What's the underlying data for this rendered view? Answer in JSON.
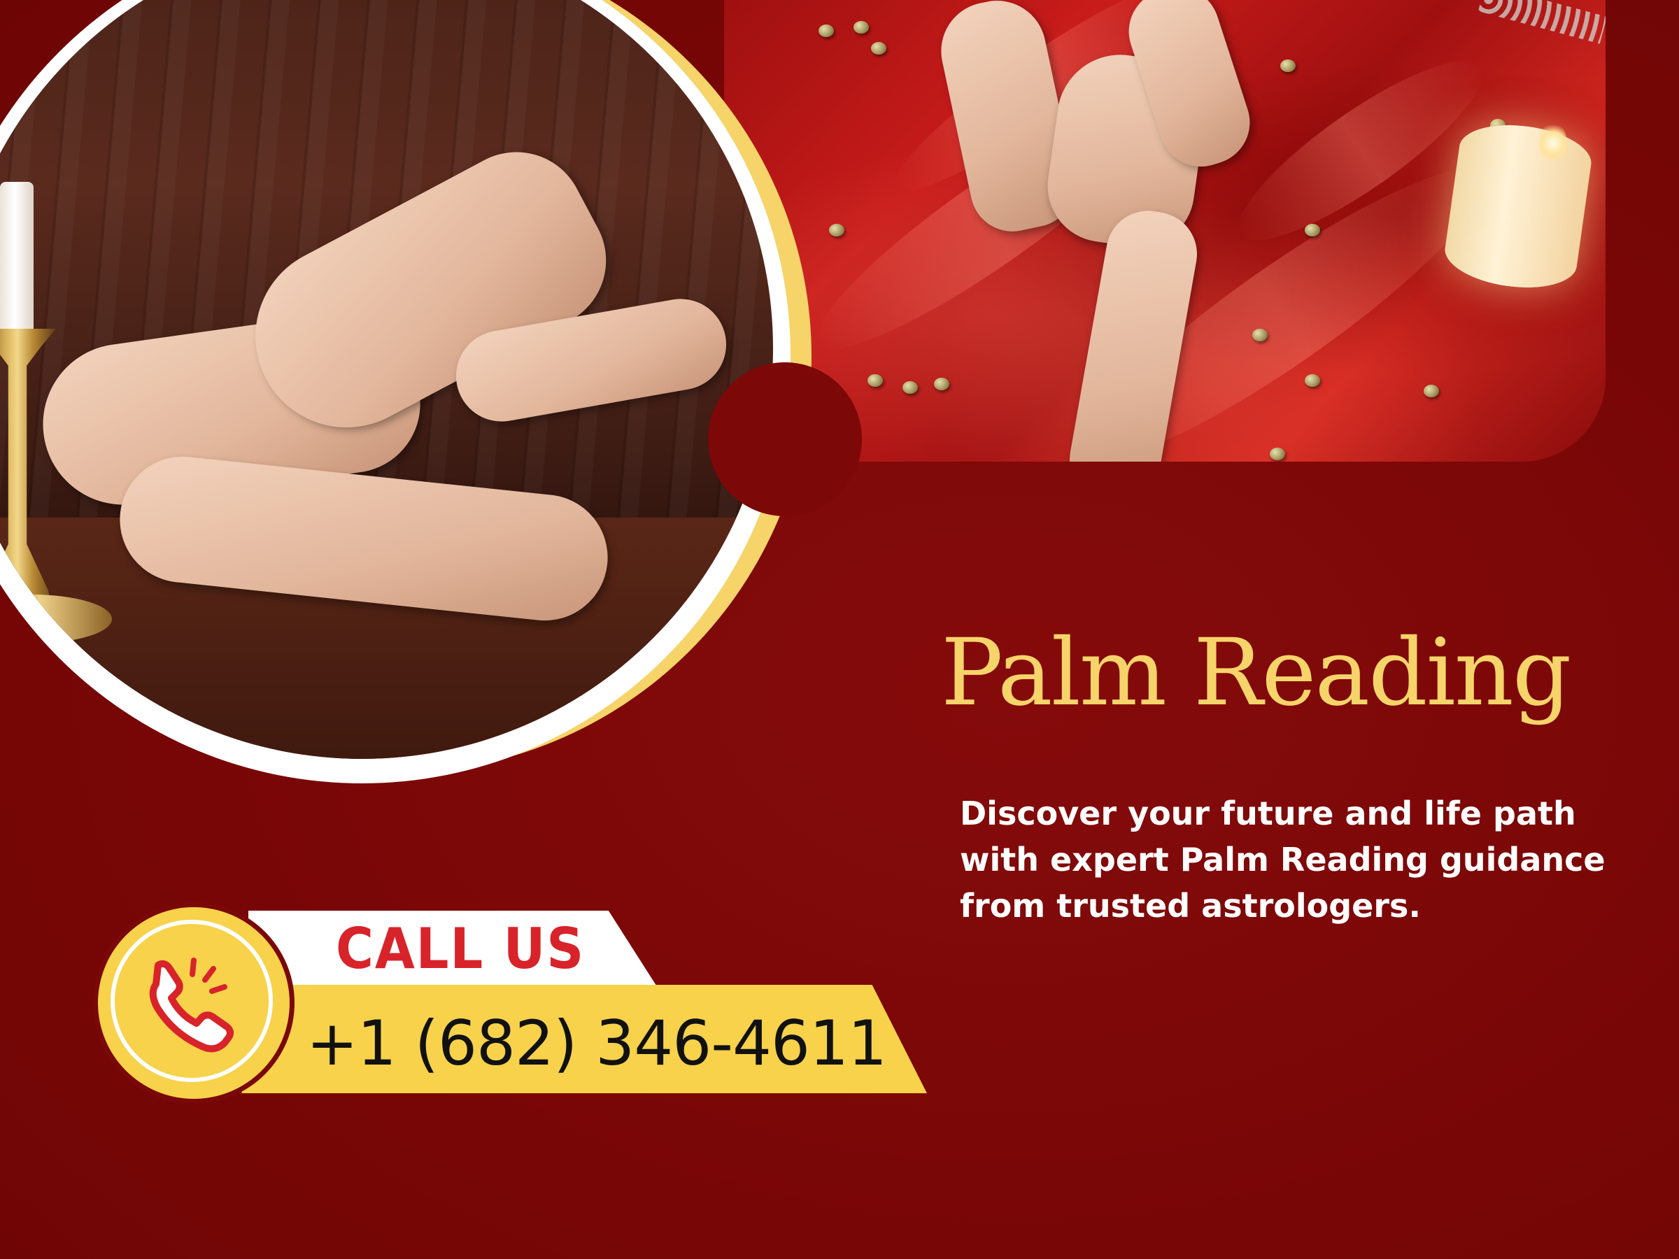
{
  "hero": {
    "title": "Palm Reading",
    "description": "Discover your future and life path with expert Palm Reading guidance from trusted astrologers."
  },
  "contact": {
    "call_label": "CALL US",
    "phone": "+1 (682) 346-4611"
  },
  "images": {
    "left": "palm-reading-hands-photo",
    "right": "palm-reading-red-satin-photo"
  },
  "icons": {
    "phone": "phone-ringing-icon"
  },
  "colors": {
    "background": "#7a0808",
    "accent_gold": "#f6d46a",
    "badge_yellow": "#f7d24a",
    "call_red": "#d8232a",
    "text_white": "#ffffff"
  }
}
